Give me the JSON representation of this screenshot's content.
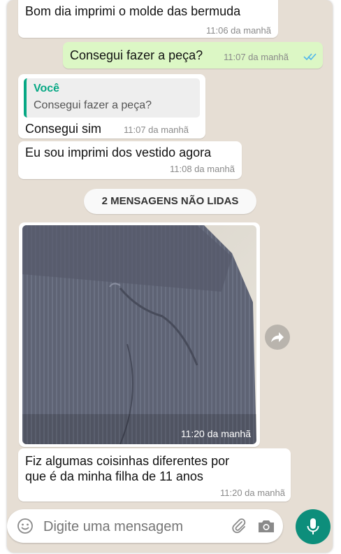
{
  "messages": [
    {
      "id": "m1",
      "direction": "in",
      "text": "Bom dia imprimi o molde das bermuda",
      "time": "11:06 da manhã"
    },
    {
      "id": "m2",
      "direction": "out",
      "text": "Consegui fazer a peça?",
      "time": "11:07 da manhã",
      "status": "read"
    },
    {
      "id": "m3",
      "direction": "in",
      "quote_author": "Você",
      "quote_text": "Consegui fazer a peça?",
      "text": "Consegui sim",
      "time": "11:07 da manhã"
    },
    {
      "id": "m4",
      "direction": "in",
      "text": "Eu sou imprimi dos vestido agora",
      "time": "11:08 da manhã"
    },
    {
      "id": "m5",
      "direction": "in",
      "type": "image",
      "time": "11:20 da manhã"
    },
    {
      "id": "m6",
      "direction": "in",
      "text_line1": "Fiz algumas coisinhas diferentes por",
      "text_line2": "que é da minha filha de 11 anos",
      "time": "11:20 da manhã"
    }
  ],
  "unread_banner": "2 MENSAGENS NÃO LIDAS",
  "composer": {
    "placeholder": "Digite uma mensagem"
  },
  "icons": [
    "emoji-icon",
    "attach-icon",
    "camera-icon",
    "mic-icon",
    "forward-icon",
    "read-ticks-icon"
  ],
  "colors": {
    "chat_bg": "#e6ded4",
    "outgoing_bubble": "#dcf7c5",
    "accent": "#06a884",
    "mic_button": "#0d8e7b",
    "read_ticks": "#4fb6ec"
  }
}
